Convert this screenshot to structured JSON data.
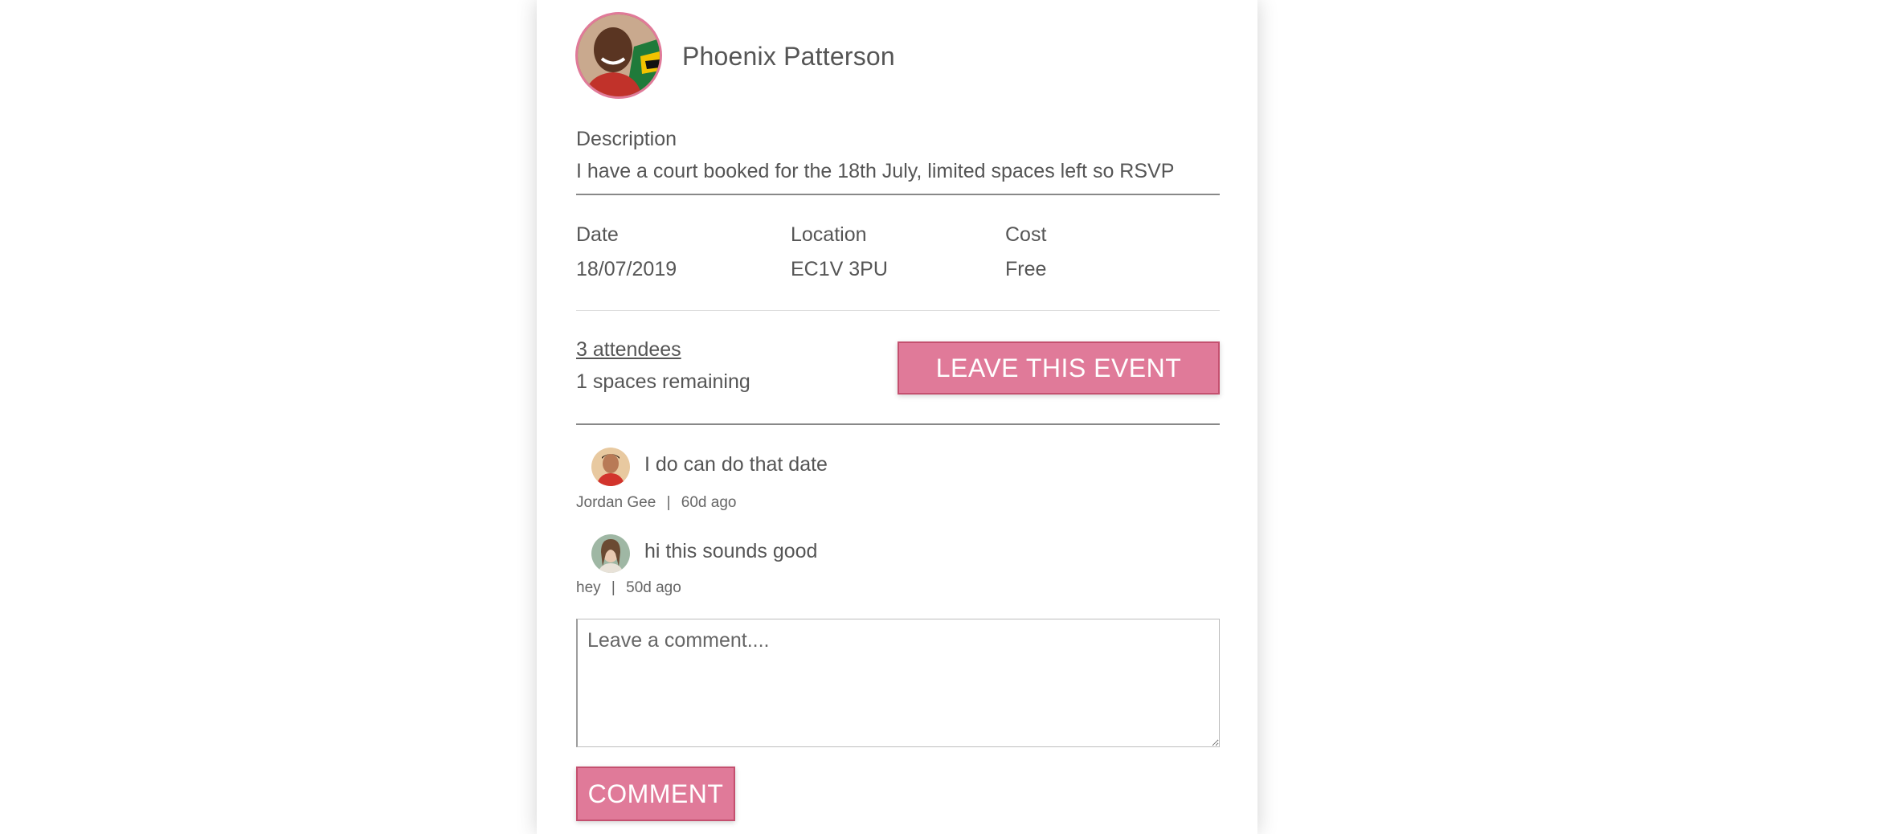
{
  "host": {
    "name": "Phoenix Patterson"
  },
  "event": {
    "description_label": "Description",
    "description": "I have a court booked for the 18th July, limited spaces left so RSVP",
    "date_label": "Date",
    "date": "18/07/2019",
    "location_label": "Location",
    "location": "EC1V 3PU",
    "cost_label": "Cost",
    "cost": "Free",
    "attendees": "3 attendees",
    "spaces_remaining": "1 spaces remaining",
    "leave_button": "LEAVE THIS EVENT"
  },
  "comments": [
    {
      "text": "I do can do that date",
      "author": "Jordan Gee",
      "separator": "|",
      "time": "60d ago"
    },
    {
      "text": "hi this sounds good",
      "author": "hey",
      "separator": "|",
      "time": "50d ago"
    }
  ],
  "comment_form": {
    "placeholder": "Leave a comment....",
    "submit_label": "COMMENT"
  },
  "colors": {
    "accent": "#e07a99",
    "accent_border": "#c4506f",
    "text": "#555555"
  }
}
